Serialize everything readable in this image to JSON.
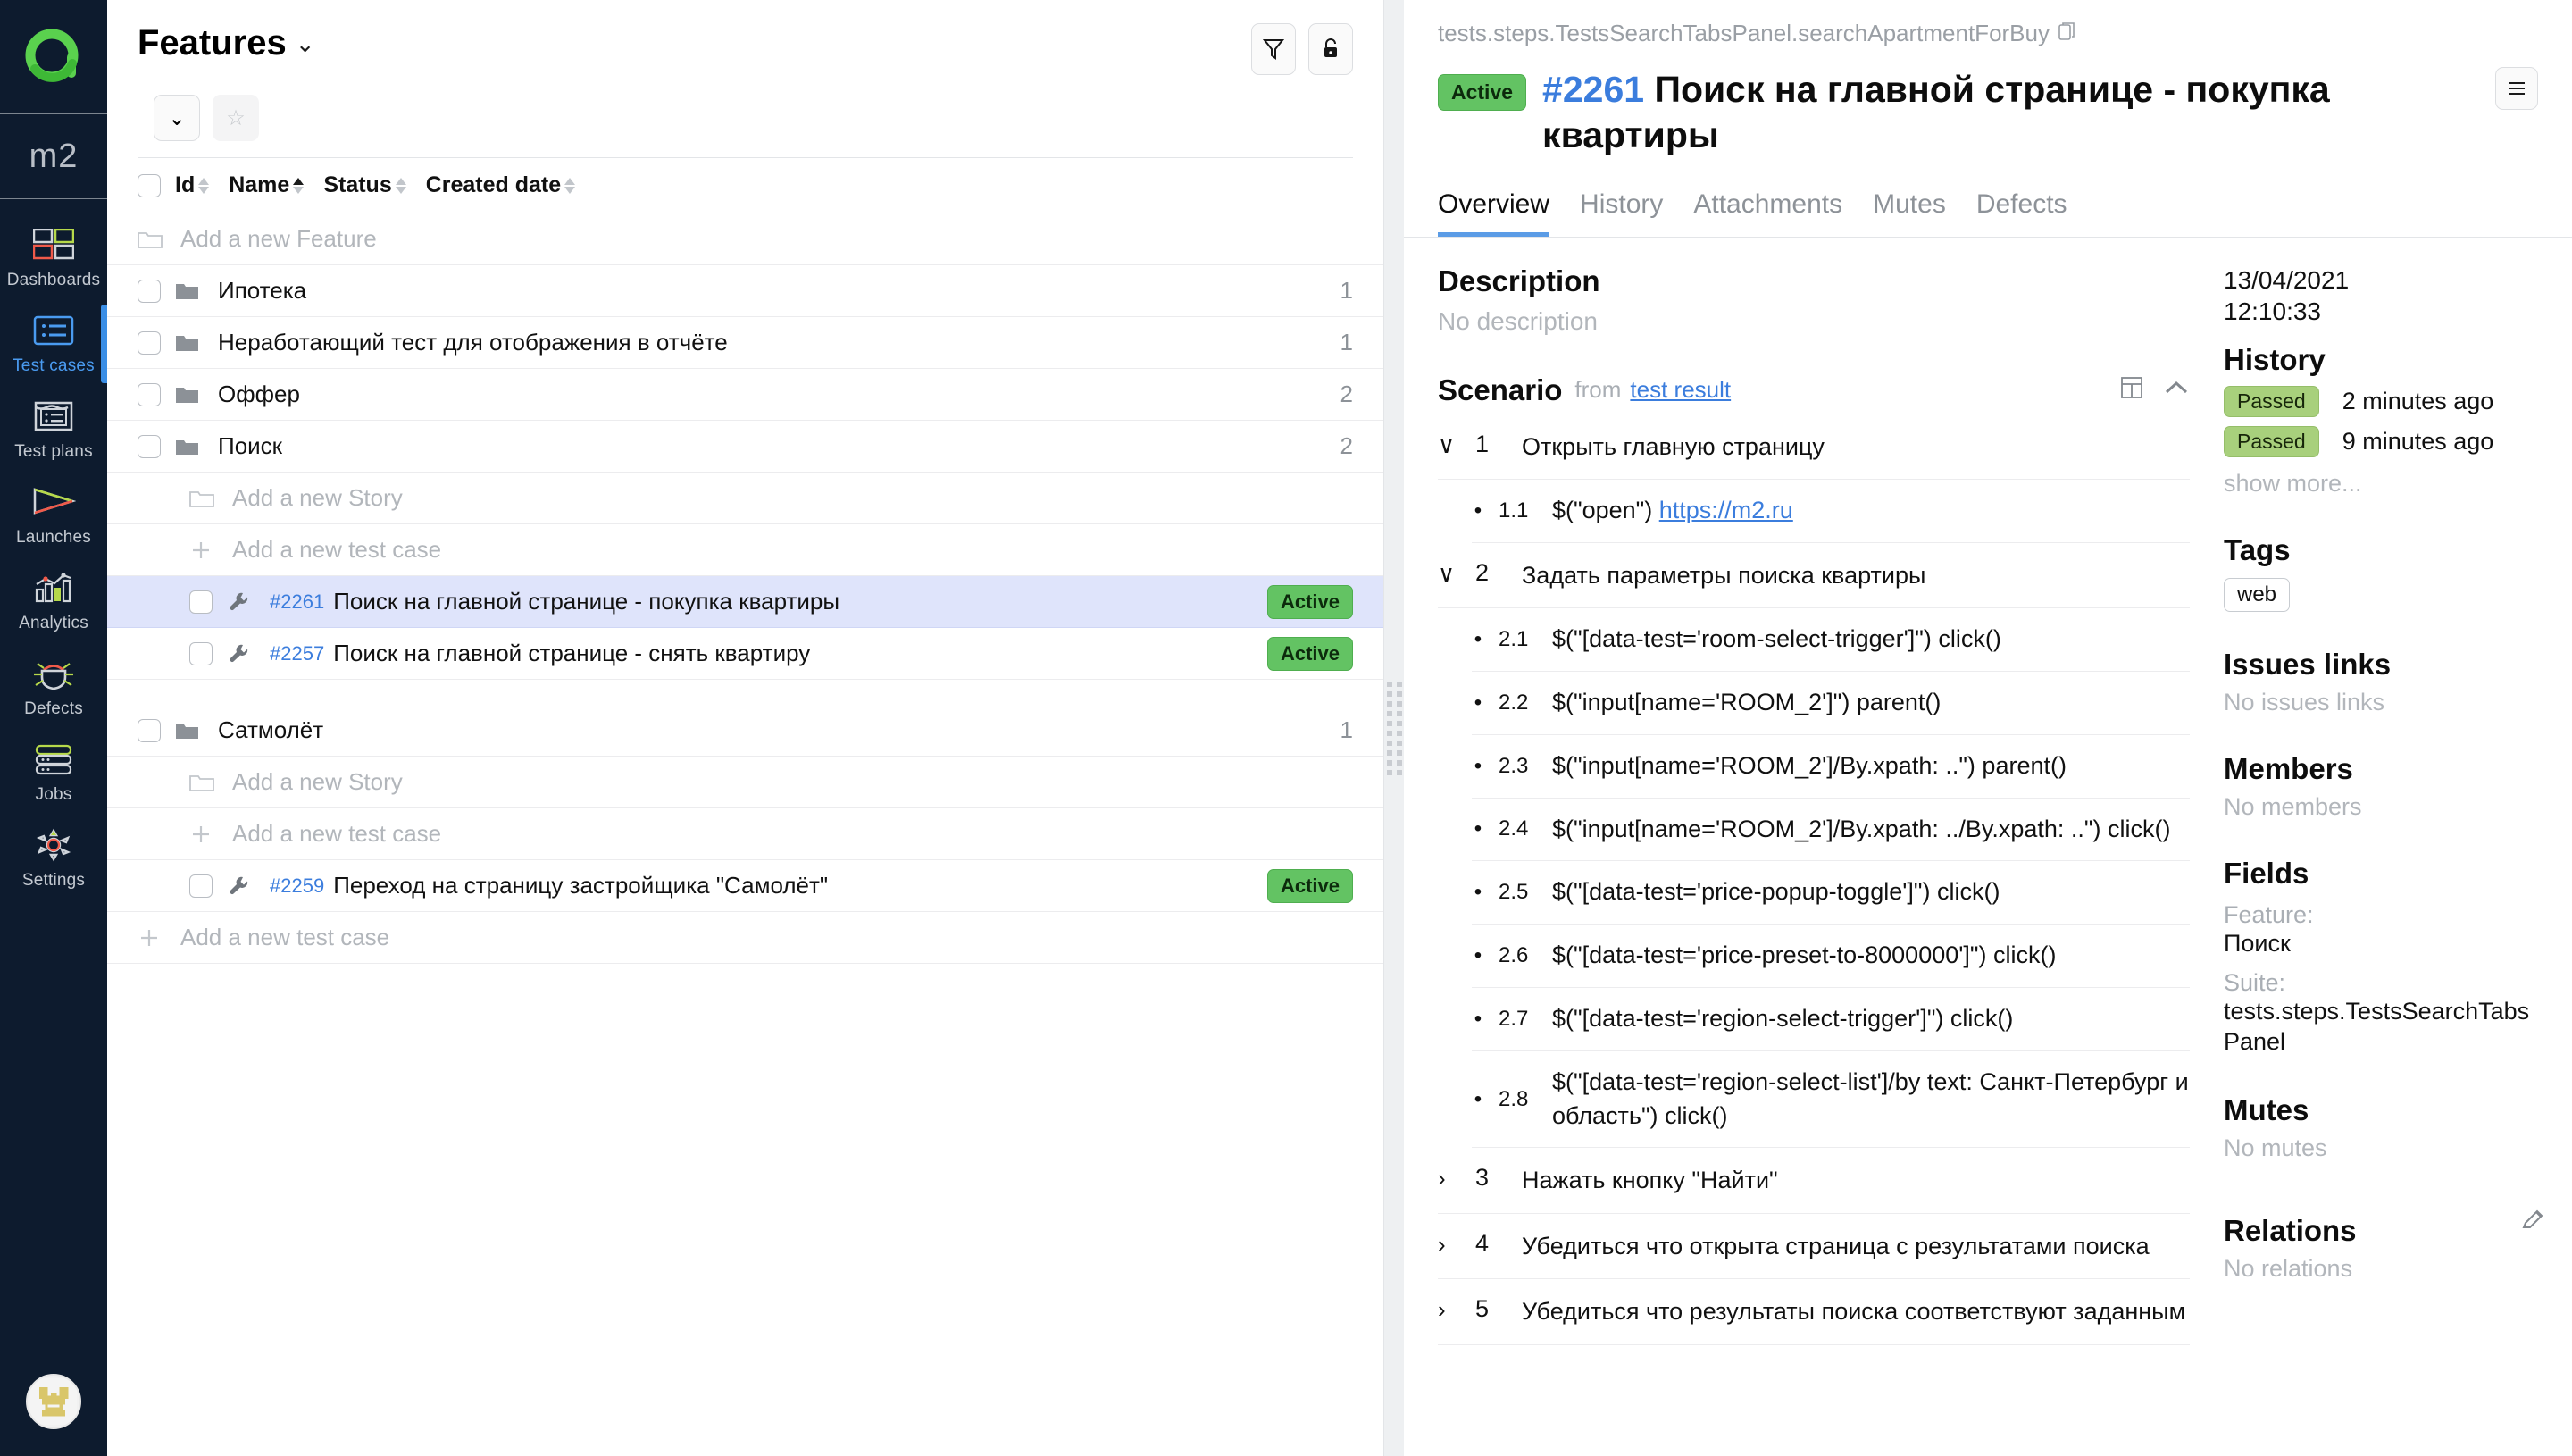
{
  "rail": {
    "logo_icon": "allure-a-logo",
    "project": "m2",
    "items": [
      {
        "label": "Dashboards",
        "icon": "dashboards-icon",
        "active": false
      },
      {
        "label": "Test cases",
        "icon": "test-cases-icon",
        "active": true
      },
      {
        "label": "Test plans",
        "icon": "test-plans-icon",
        "active": false
      },
      {
        "label": "Launches",
        "icon": "launches-icon",
        "active": false
      },
      {
        "label": "Analytics",
        "icon": "analytics-icon",
        "active": false
      },
      {
        "label": "Defects",
        "icon": "defects-icon",
        "active": false
      },
      {
        "label": "Jobs",
        "icon": "jobs-icon",
        "active": false
      },
      {
        "label": "Settings",
        "icon": "settings-icon",
        "active": false
      }
    ],
    "avatar_icon": "user-avatar"
  },
  "left_panel": {
    "title": "Features",
    "title_chevron": "⌄",
    "filter_icon": "filter-icon",
    "lock_icon": "lock-icon",
    "collapse_icon": "⌄",
    "star_icon": "☆",
    "columns": [
      {
        "label": "Id",
        "sort": "none"
      },
      {
        "label": "Name",
        "sort": "asc"
      },
      {
        "label": "Status",
        "sort": "none"
      },
      {
        "label": "Created date",
        "sort": "none"
      }
    ],
    "rows": [
      {
        "kind": "add-feature",
        "label": "Add a new Feature",
        "icon": "folder-outline-icon",
        "indent": 0
      },
      {
        "kind": "feature",
        "label": "Ипотека",
        "count": "1",
        "icon": "folder-icon",
        "indent": 0
      },
      {
        "kind": "feature",
        "label": "Неработающий тест для отображения в отчёте",
        "count": "1",
        "icon": "folder-icon",
        "indent": 0
      },
      {
        "kind": "feature",
        "label": "Оффер",
        "count": "2",
        "icon": "folder-icon",
        "indent": 0
      },
      {
        "kind": "feature",
        "label": "Поиск",
        "count": "2",
        "icon": "folder-open-icon",
        "indent": 0
      },
      {
        "kind": "add-story",
        "label": "Add a new Story",
        "icon": "folder-outline-icon",
        "indent": 1
      },
      {
        "kind": "add-test",
        "label": "Add a new test case",
        "icon": "plus-icon",
        "indent": 1
      },
      {
        "kind": "test",
        "id": "#2261",
        "label": "Поиск на главной странице - покупка квартиры",
        "status": "Active",
        "icon": "wrench-icon",
        "indent": 1,
        "selected": true
      },
      {
        "kind": "test",
        "id": "#2257",
        "label": "Поиск на главной странице - снять квартиру",
        "status": "Active",
        "icon": "wrench-icon",
        "indent": 1,
        "selected": false
      },
      {
        "kind": "spacer"
      },
      {
        "kind": "feature",
        "label": "Сатмолёт",
        "count": "1",
        "icon": "folder-open-icon",
        "indent": 0
      },
      {
        "kind": "add-story",
        "label": "Add a new Story",
        "icon": "folder-outline-icon",
        "indent": 1
      },
      {
        "kind": "add-test",
        "label": "Add a new test case",
        "icon": "plus-icon",
        "indent": 1
      },
      {
        "kind": "test",
        "id": "#2259",
        "label": "Переход на страницу застройщика \"Самолёт\"",
        "status": "Active",
        "icon": "wrench-icon",
        "indent": 1,
        "selected": false
      },
      {
        "kind": "add-test-root",
        "label": "Add a new test case",
        "icon": "plus-icon",
        "indent": 0
      }
    ]
  },
  "right_panel": {
    "breadcrumb": "tests.steps.TestsSearchTabsPanel.searchApartmentForBuy",
    "copy_icon": "copy-icon",
    "status_badge": "Active",
    "test_number": "#2261",
    "test_title": "Поиск на главной странице - покупка квартиры",
    "menu_icon": "hamburger-icon",
    "tabs": [
      {
        "label": "Overview",
        "active": true
      },
      {
        "label": "History",
        "active": false
      },
      {
        "label": "Attachments",
        "active": false
      },
      {
        "label": "Mutes",
        "active": false
      },
      {
        "label": "Defects",
        "active": false
      }
    ],
    "description": {
      "heading": "Description",
      "empty": "No description"
    },
    "scenario": {
      "heading": "Scenario",
      "from_label": "from",
      "from_link": "test result",
      "layout_icon": "layout-icon",
      "collapse_icon": "chevron-up-icon",
      "steps": [
        {
          "num": "1",
          "text": "Открыть главную страницу",
          "expanded": true,
          "substeps": [
            {
              "num": "1.1",
              "text": "$(\"open\") ",
              "link": "https://m2.ru"
            }
          ]
        },
        {
          "num": "2",
          "text": "Задать параметры поиска квартиры",
          "expanded": true,
          "substeps": [
            {
              "num": "2.1",
              "text": "$(\"[data-test='room-select-trigger']\") click()"
            },
            {
              "num": "2.2",
              "text": "$(\"input[name='ROOM_2']\") parent()"
            },
            {
              "num": "2.3",
              "text": "$(\"input[name='ROOM_2']/By.xpath: ..\") parent()"
            },
            {
              "num": "2.4",
              "text": "$(\"input[name='ROOM_2']/By.xpath: ../By.xpath: ..\") click()"
            },
            {
              "num": "2.5",
              "text": "$(\"[data-test='price-popup-toggle']\") click()"
            },
            {
              "num": "2.6",
              "text": "$(\"[data-test='price-preset-to-8000000']\") click()"
            },
            {
              "num": "2.7",
              "text": "$(\"[data-test='region-select-trigger']\") click()"
            },
            {
              "num": "2.8",
              "text": "$(\"[data-test='region-select-list']/by text: Санкт-Петербург и область\") click()"
            }
          ]
        },
        {
          "num": "3",
          "text": "Нажать кнопку \"Найти\"",
          "expanded": false,
          "substeps": []
        },
        {
          "num": "4",
          "text": "Убедиться что открыта страница с результатами поиска",
          "expanded": false,
          "substeps": []
        },
        {
          "num": "5",
          "text": "Убедиться что результаты поиска соответствуют заданным",
          "expanded": false,
          "substeps": []
        }
      ]
    },
    "side": {
      "timestamp_date": "13/04/2021",
      "timestamp_time": "12:10:33",
      "history_heading": "History",
      "history": [
        {
          "status": "Passed",
          "when": "2 minutes ago"
        },
        {
          "status": "Passed",
          "when": "9 minutes ago"
        }
      ],
      "show_more": "show more...",
      "tags_heading": "Tags",
      "tags": [
        "web"
      ],
      "issues_heading": "Issues links",
      "issues_empty": "No issues links",
      "members_heading": "Members",
      "members_empty": "No members",
      "fields_heading": "Fields",
      "fields": [
        {
          "key": "Feature:",
          "value": "Поиск"
        },
        {
          "key": "Suite:",
          "value": "tests.steps.TestsSearchTabsPanel"
        }
      ],
      "mutes_heading": "Mutes",
      "mutes_empty": "No mutes",
      "relations_heading": "Relations",
      "relations_empty": "No relations",
      "edit_icon": "pencil-icon"
    }
  },
  "colors": {
    "accent_blue": "#3b7ddd",
    "status_green": "#63c363",
    "passed_green": "#a8d07c",
    "rail_bg": "#0d1b2e",
    "selected_row": "#dfe4fb"
  }
}
